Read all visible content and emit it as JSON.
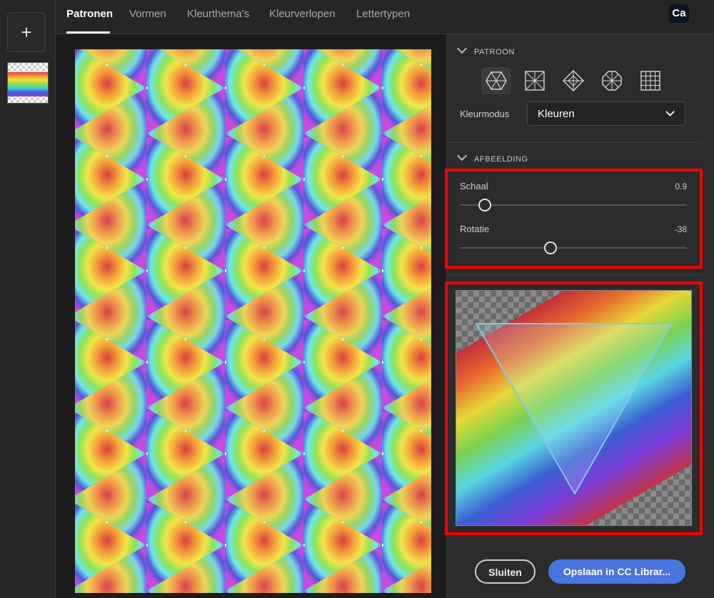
{
  "sidebar": {
    "add_icon": "plus-icon",
    "add_glyph": "+",
    "thumbnail_icon": "rainbow-swatch-thumbnail"
  },
  "tabs": [
    {
      "label": "Patronen",
      "active": true
    },
    {
      "label": "Vormen",
      "active": false
    },
    {
      "label": "Kleurthema's",
      "active": false
    },
    {
      "label": "Kleurverlopen",
      "active": false
    },
    {
      "label": "Lettertypen",
      "active": false
    }
  ],
  "app_badge": "Ca",
  "panel": {
    "pattern_section": {
      "title": "PATROON",
      "shape_icons": [
        "hexagon-pattern-icon",
        "square-pattern-icon",
        "diamond-pattern-icon",
        "octagon-pattern-icon",
        "grid-pattern-icon"
      ],
      "selected_shape": 0,
      "color_mode_label": "Kleurmodus",
      "color_mode_value": "Kleuren"
    },
    "image_section": {
      "title": "AFBEELDING",
      "scale_label": "Schaal",
      "scale_value": "0.9",
      "scale_fraction": 0.11,
      "rotation_label": "Rotatie",
      "rotation_value": "-38",
      "rotation_fraction": 0.4
    },
    "buttons": {
      "close": "Sluiten",
      "save": "Opslaan in CC Librar..."
    }
  },
  "colors": {
    "accent": "#4a74e0",
    "highlight": "#ff0000",
    "background": "#1e1e1e",
    "panel": "#2c2c2c"
  }
}
